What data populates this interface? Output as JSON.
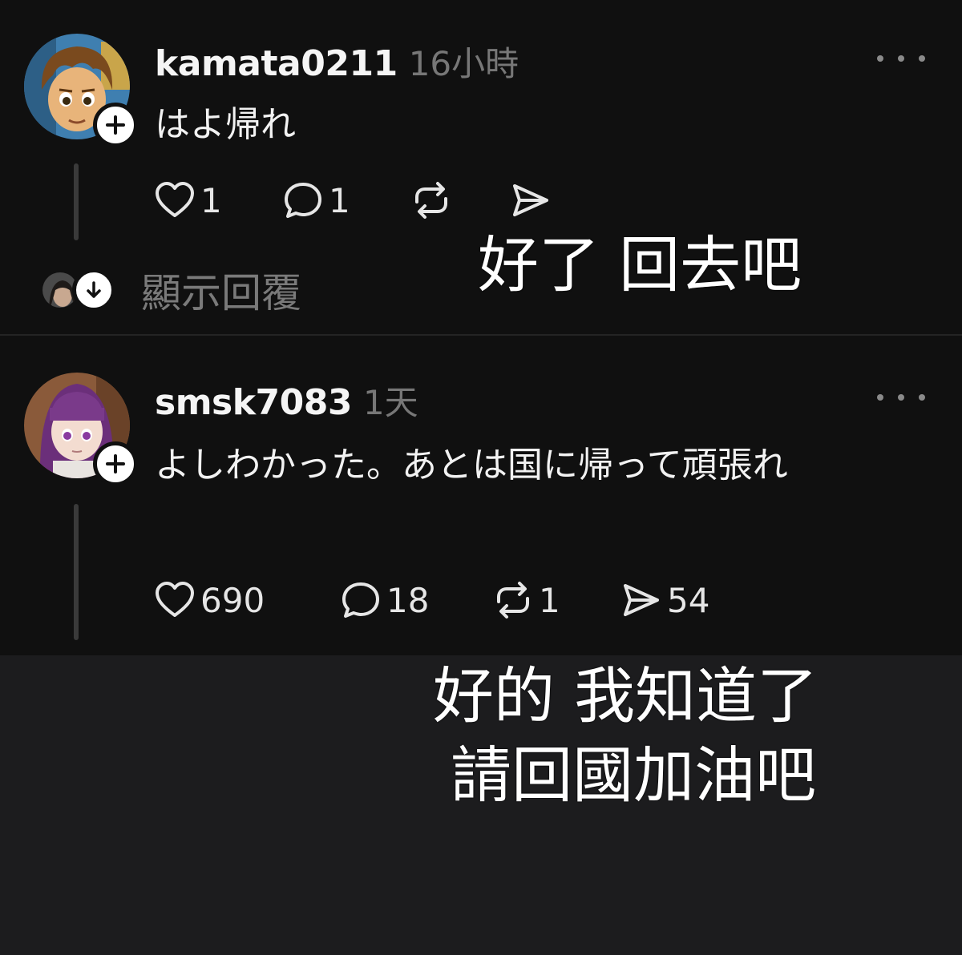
{
  "posts": [
    {
      "username": "kamata0211",
      "time": "16小時",
      "text": "はよ帰れ",
      "likes": "1",
      "replies": "1",
      "reposts": "",
      "shares": "",
      "show_replies": "顯示回覆"
    },
    {
      "username": "smsk7083",
      "time": "1天",
      "text": "よしわかった。あとは国に帰って頑張れ",
      "likes": "690",
      "replies": "18",
      "reposts": "1",
      "shares": "54"
    }
  ],
  "captions": {
    "first": "好了 回去吧",
    "second_line1": "好的 我知道了",
    "second_line2": "請回國加油吧"
  },
  "colors": {
    "feed_background": "#101010",
    "page_background": "#1c1c1e",
    "muted_text": "#777777",
    "text": "#f2f2f2"
  },
  "icons": {
    "like": "heart-icon",
    "reply": "comment-icon",
    "repost": "repost-icon",
    "share": "send-icon",
    "follow": "plus-icon",
    "expand": "arrow-down-icon",
    "menu": "more-icon"
  }
}
